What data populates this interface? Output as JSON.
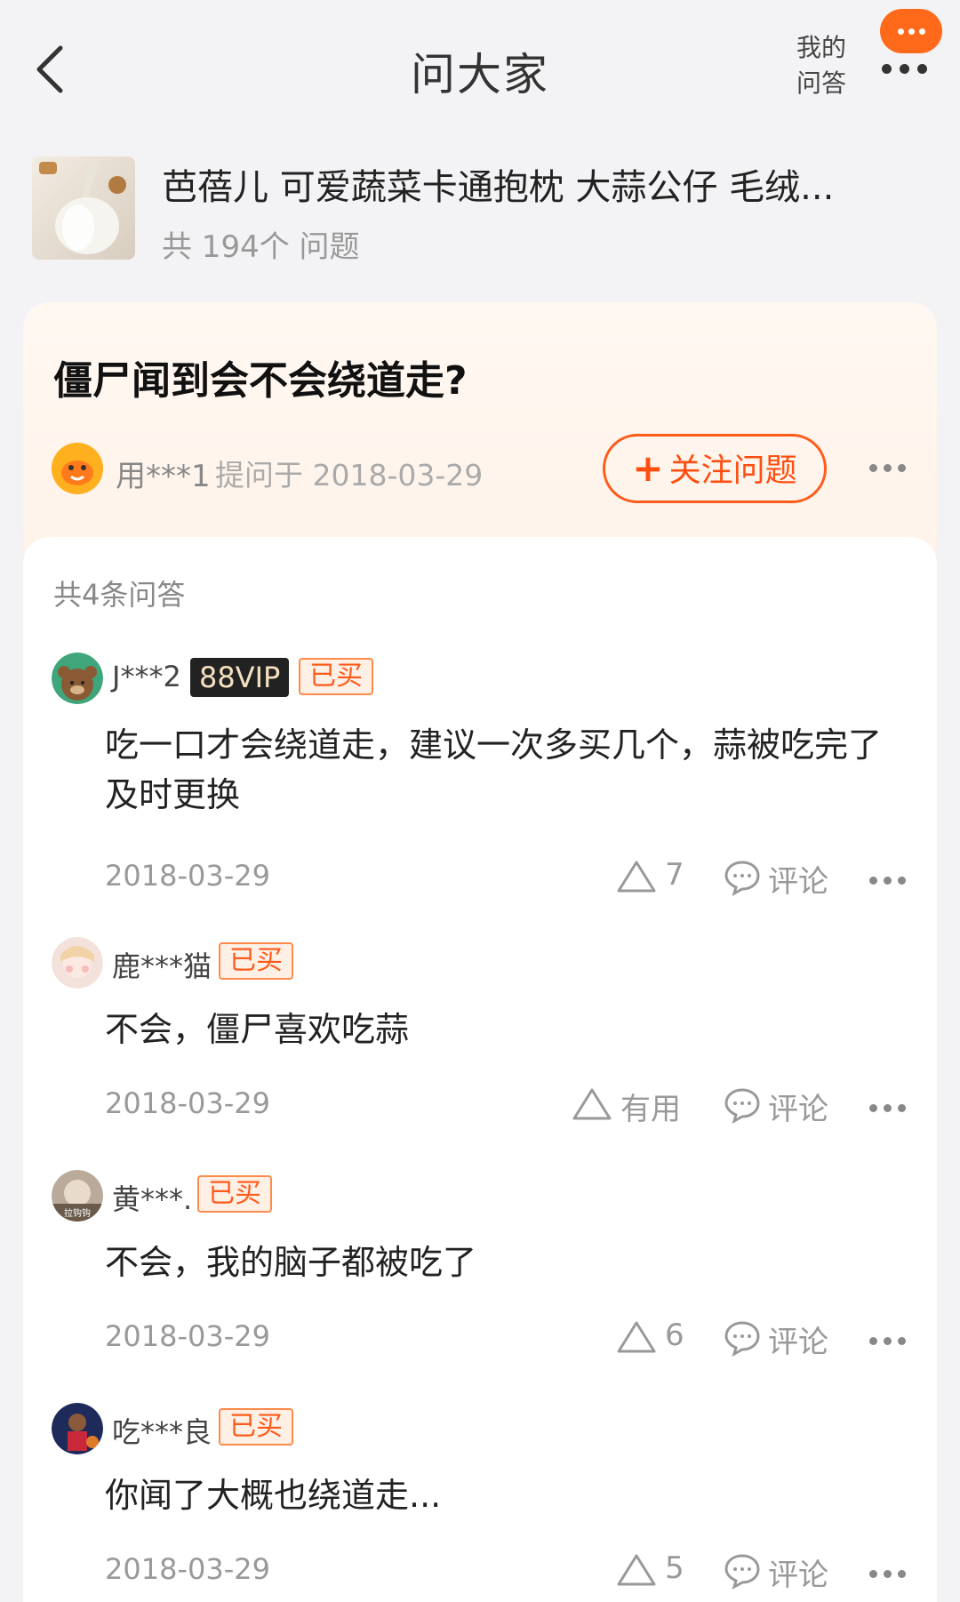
{
  "header": {
    "title": "问大家",
    "my_qa_line1": "我的",
    "my_qa_line2": "问答"
  },
  "product": {
    "title": "芭蓓儿 可爱蔬菜卡通抱枕 大蒜公仔 毛绒...",
    "question_count": "共 194个 问题"
  },
  "question": {
    "title": "僵尸闻到会不会绕道走?",
    "user": "用***1",
    "asked_on": "提问于 2018-03-29",
    "follow_label": "关注问题"
  },
  "answers_header": "共4条问答",
  "answers": [
    {
      "user": "J***2",
      "vip": "88VIP",
      "bought": "已买",
      "text": "吃一口才会绕道走，建议一次多买几个，蒜被吃完了及时更换",
      "date": "2018-03-29",
      "likes": "7",
      "comment_label": "评论"
    },
    {
      "user": "鹿***猫",
      "bought": "已买",
      "text": "不会，僵尸喜欢吃蒜",
      "date": "2018-03-29",
      "likes": "有用",
      "comment_label": "评论"
    },
    {
      "user": "黄***.",
      "bought": "已买",
      "avatar_text": "拉钩钩",
      "text": "不会，我的脑子都被吃了",
      "date": "2018-03-29",
      "likes": "6",
      "comment_label": "评论"
    },
    {
      "user": "吃***良",
      "bought": "已买",
      "text": "你闻了大概也绕道走...",
      "date": "2018-03-29",
      "likes": "5",
      "comment_label": "评论"
    }
  ],
  "colors": {
    "accent": "#ff5b1a",
    "bought_bg": "#fff0e6",
    "vip_bg": "#222222",
    "vip_text": "#f5e1c0"
  },
  "icons": [
    "back-arrow-icon",
    "message-bubble-icon",
    "more-dots-icon",
    "plus-icon",
    "like-triangle-icon",
    "comment-bubble-icon"
  ]
}
